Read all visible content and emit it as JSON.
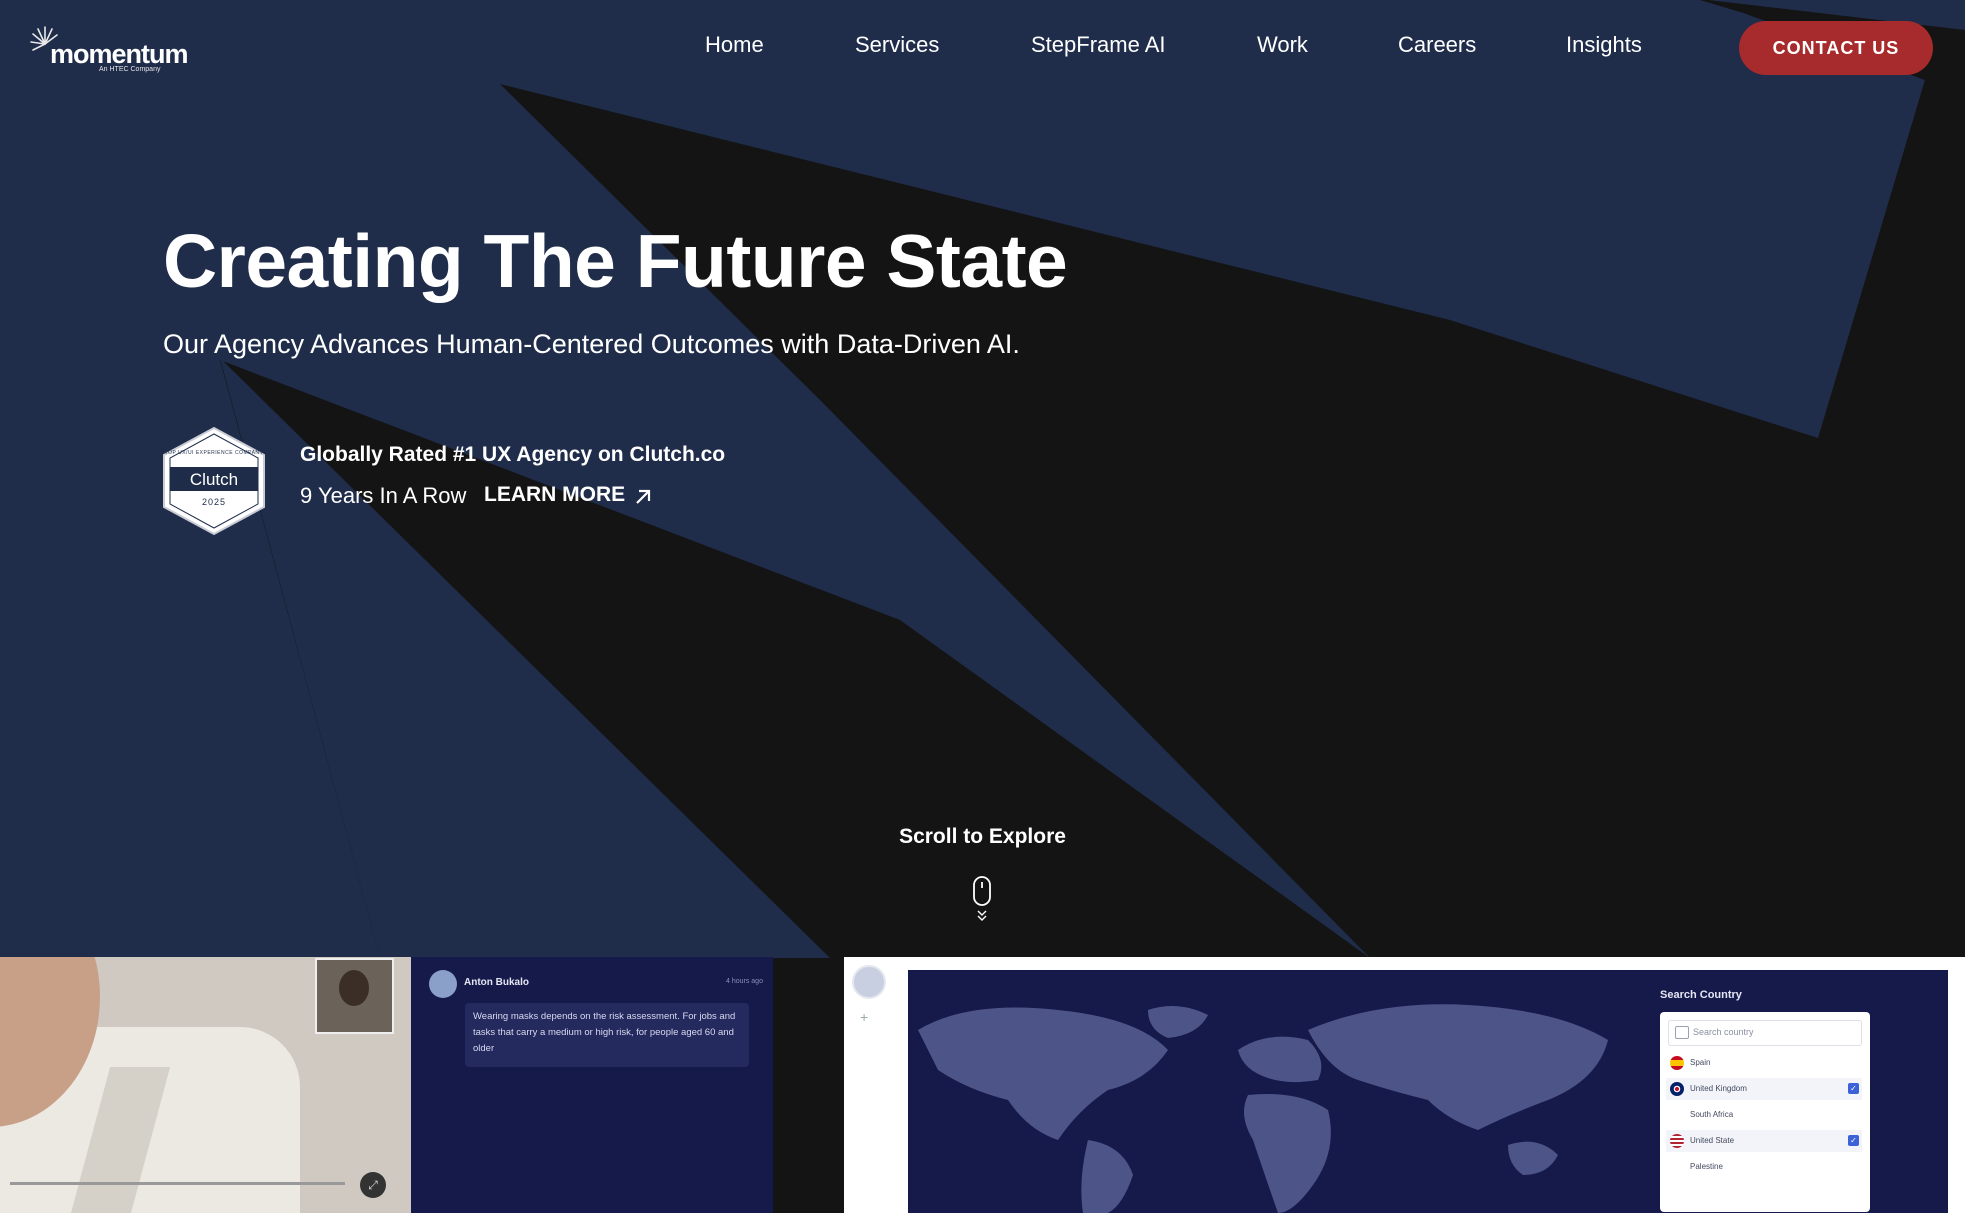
{
  "header": {
    "logo": {
      "wordmark": "momentum",
      "tagline": "An HTEC Company"
    },
    "nav": [
      {
        "label": "Home"
      },
      {
        "label": "Services"
      },
      {
        "label": "StepFrame AI"
      },
      {
        "label": "Work"
      },
      {
        "label": "Careers"
      },
      {
        "label": "Insights"
      }
    ],
    "cta_label": "CONTACT US"
  },
  "hero": {
    "title": "Creating The Future State",
    "subtitle": "Our Agency Advances Human-Centered Outcomes with Data-Driven AI.",
    "badge": {
      "top_text": "TOP UX/UI EXPERIENCE COMPANY",
      "name": "Clutch",
      "year": "2025"
    },
    "rating_title": "Globally Rated #1 UX Agency on Clutch.co",
    "rating_detail": "9 Years In A Row",
    "learn_more": "LEARN MORE",
    "scroll_label": "Scroll to Explore"
  },
  "previews": {
    "chat": {
      "sender": "Anton Bukalo",
      "time": "4 hours ago",
      "message": "Wearing masks depends on the risk assessment. For jobs and tasks that carry a medium or high risk, for people aged 60 and older"
    },
    "map": {
      "search_title": "Search Country",
      "search_placeholder": "Search country",
      "countries": [
        {
          "label": "Spain",
          "selected": false,
          "checked": false
        },
        {
          "label": "United Kingdom",
          "selected": true,
          "checked": true
        },
        {
          "label": "South Africa",
          "selected": false,
          "checked": false
        },
        {
          "label": "United State",
          "selected": true,
          "checked": true
        },
        {
          "label": "Palestine",
          "selected": false,
          "checked": false
        }
      ]
    }
  },
  "colors": {
    "navy": "#1f2d4b",
    "dark": "#141414",
    "accent": "#a72a2c"
  },
  "icons": [
    "momentum-logo-icon",
    "arrow-up-right-icon",
    "mouse-scroll-icon",
    "chevron-down-icon",
    "expand-icon"
  ]
}
